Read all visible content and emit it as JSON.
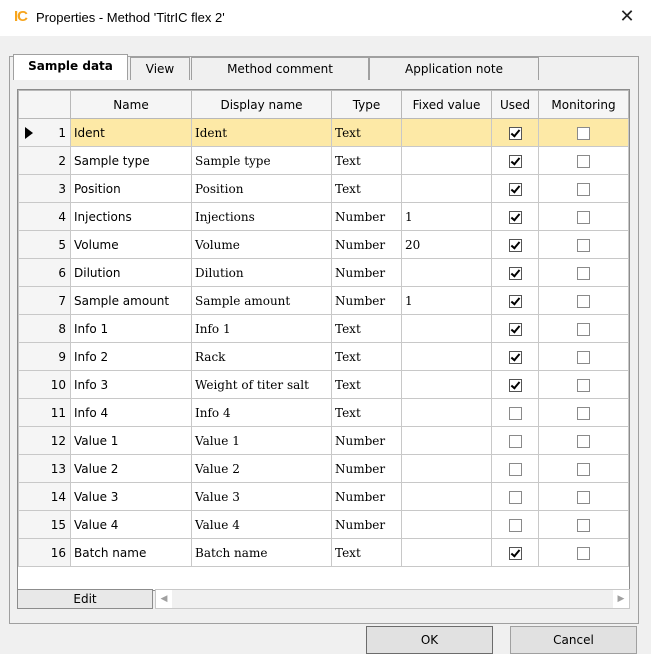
{
  "window": {
    "title": "Properties - Method 'TitrIC flex 2'",
    "logo_text": "IC",
    "close_symbol": "✕"
  },
  "tabs": [
    {
      "label": "Sample data",
      "active": true
    },
    {
      "label": "View",
      "active": false
    },
    {
      "label": "Method comment",
      "active": false
    },
    {
      "label": "Application note",
      "active": false
    }
  ],
  "grid": {
    "columns": [
      "",
      "Name",
      "Display name",
      "Type",
      "Fixed value",
      "Used",
      "Monitoring"
    ],
    "selected_row": 1,
    "rows": [
      {
        "num": "1",
        "name": "Ident",
        "display": "Ident",
        "type": "Text",
        "fixed": "",
        "used": true,
        "monitoring": false
      },
      {
        "num": "2",
        "name": "Sample type",
        "display": "Sample type",
        "type": "Text",
        "fixed": "",
        "used": true,
        "monitoring": false
      },
      {
        "num": "3",
        "name": "Position",
        "display": "Position",
        "type": "Text",
        "fixed": "",
        "used": true,
        "monitoring": false
      },
      {
        "num": "4",
        "name": "Injections",
        "display": "Injections",
        "type": "Number",
        "fixed": "1",
        "used": true,
        "monitoring": false
      },
      {
        "num": "5",
        "name": "Volume",
        "display": "Volume",
        "type": "Number",
        "fixed": "20",
        "used": true,
        "monitoring": false
      },
      {
        "num": "6",
        "name": "Dilution",
        "display": "Dilution",
        "type": "Number",
        "fixed": "",
        "used": true,
        "monitoring": false
      },
      {
        "num": "7",
        "name": "Sample amount",
        "display": "Sample amount",
        "type": "Number",
        "fixed": "1",
        "used": true,
        "monitoring": false
      },
      {
        "num": "8",
        "name": "Info 1",
        "display": "Info 1",
        "type": "Text",
        "fixed": "",
        "used": true,
        "monitoring": false
      },
      {
        "num": "9",
        "name": "Info 2",
        "display": "Rack",
        "type": "Text",
        "fixed": "",
        "used": true,
        "monitoring": false
      },
      {
        "num": "10",
        "name": "Info 3",
        "display": "Weight of titer salt",
        "type": "Text",
        "fixed": "",
        "used": true,
        "monitoring": false
      },
      {
        "num": "11",
        "name": "Info 4",
        "display": "Info 4",
        "type": "Text",
        "fixed": "",
        "used": false,
        "monitoring": false
      },
      {
        "num": "12",
        "name": "Value 1",
        "display": "Value 1",
        "type": "Number",
        "fixed": "",
        "used": false,
        "monitoring": false
      },
      {
        "num": "13",
        "name": "Value 2",
        "display": "Value 2",
        "type": "Number",
        "fixed": "",
        "used": false,
        "monitoring": false
      },
      {
        "num": "14",
        "name": "Value 3",
        "display": "Value 3",
        "type": "Number",
        "fixed": "",
        "used": false,
        "monitoring": false
      },
      {
        "num": "15",
        "name": "Value 4",
        "display": "Value 4",
        "type": "Number",
        "fixed": "",
        "used": false,
        "monitoring": false
      },
      {
        "num": "16",
        "name": "Batch name",
        "display": "Batch name",
        "type": "Text",
        "fixed": "",
        "used": true,
        "monitoring": false
      }
    ]
  },
  "footer": {
    "edit_label": "Edit",
    "scroll_left": "◀",
    "scroll_right": "▶"
  },
  "buttons": {
    "ok": "OK",
    "cancel": "Cancel"
  },
  "colors": {
    "selected_row": "#fde9a6",
    "logo": "#f7a51d"
  }
}
